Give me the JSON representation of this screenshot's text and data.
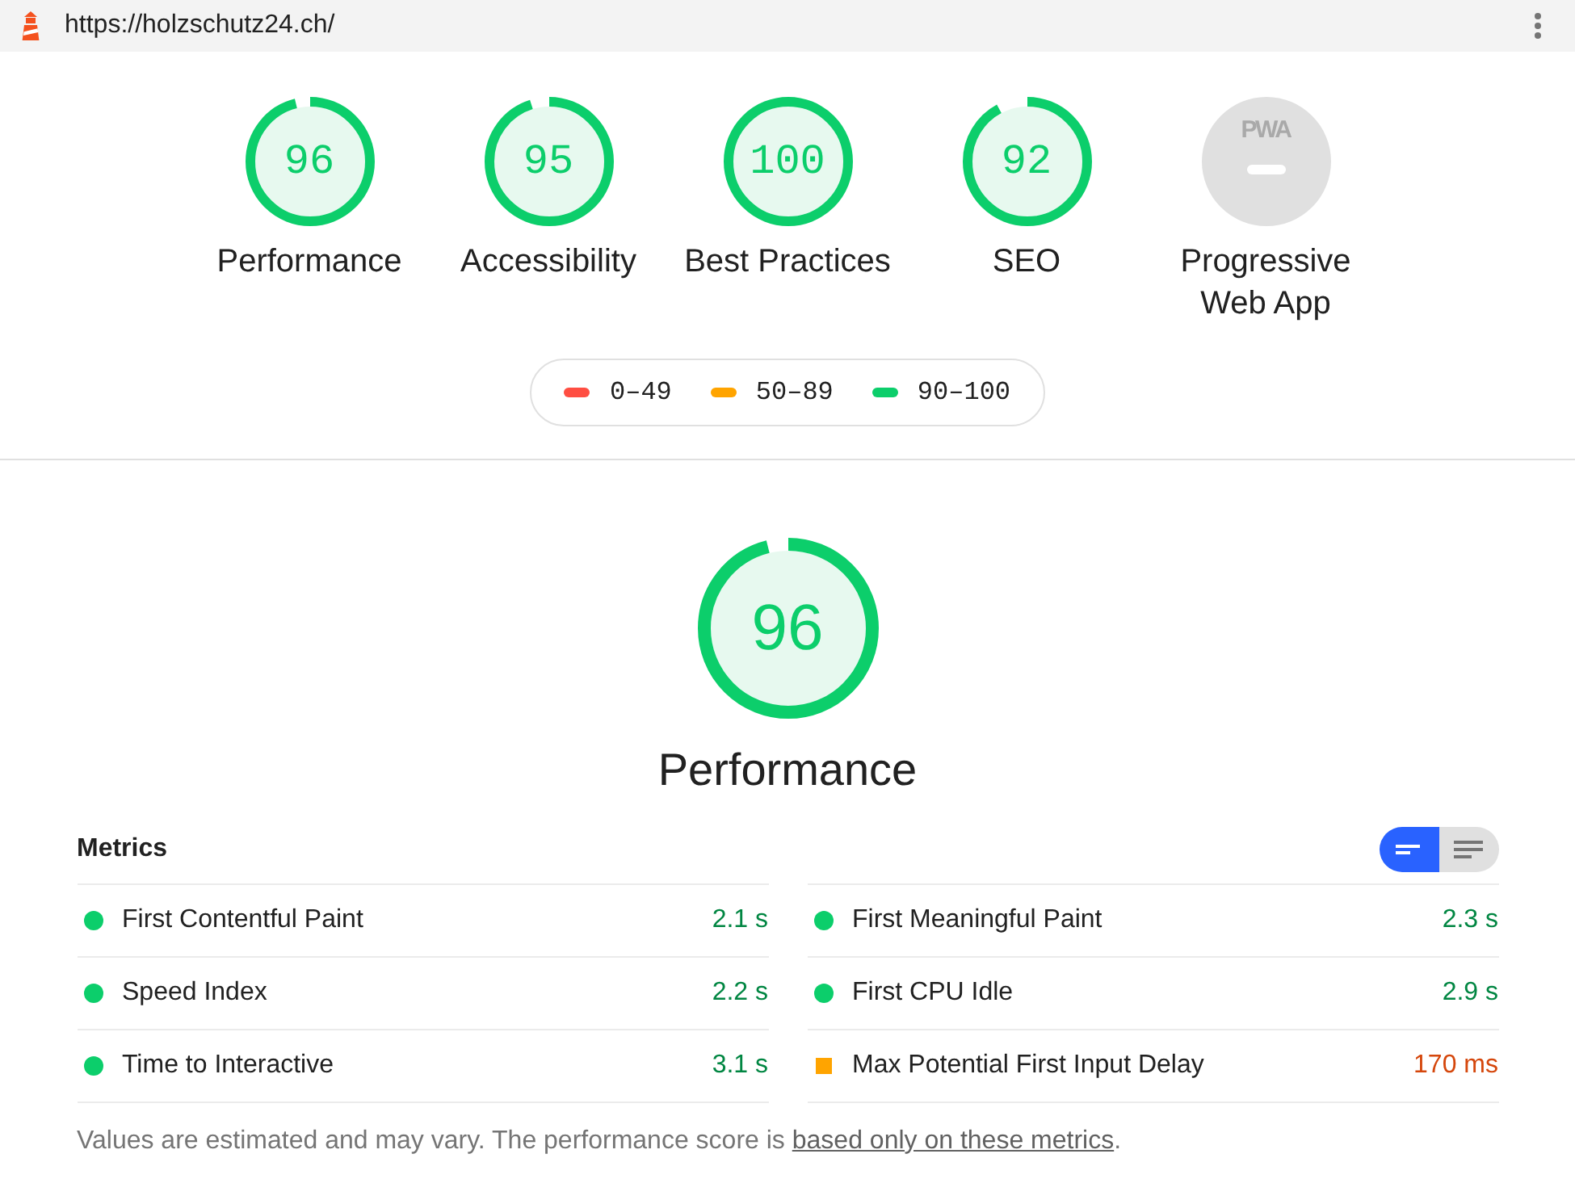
{
  "url_bar": {
    "url": "https://holzschutz24.ch/"
  },
  "categories": [
    {
      "kind": "score",
      "score": "96",
      "level": 0.96,
      "label": "Performance"
    },
    {
      "kind": "score",
      "score": "95",
      "level": 0.95,
      "label": "Accessibility"
    },
    {
      "kind": "score",
      "score": "100",
      "level": 1,
      "label": "Best Practices"
    },
    {
      "kind": "score",
      "score": "92",
      "level": 0.92,
      "label": "SEO"
    },
    {
      "kind": "pwa",
      "badge": "PWA",
      "label": "Progressive Web App"
    }
  ],
  "legend": [
    {
      "range": "0–49",
      "color": "#ff4e42"
    },
    {
      "range": "50–89",
      "color": "#ffa400"
    },
    {
      "range": "90–100",
      "color": "#0cce6b"
    }
  ],
  "performance": {
    "score": "96",
    "level": 0.96,
    "title": "Performance"
  },
  "metrics": {
    "title": "Metrics",
    "view_toggle": [
      {
        "kind": "compact",
        "selected": true
      },
      {
        "kind": "list",
        "selected": false
      }
    ],
    "items": [
      {
        "kind": "pass",
        "name": "First Contentful Paint",
        "value": "2.1 s"
      },
      {
        "kind": "pass",
        "name": "First Meaningful Paint",
        "value": "2.3 s"
      },
      {
        "kind": "pass",
        "name": "Speed Index",
        "value": "2.2 s"
      },
      {
        "kind": "pass",
        "name": "First CPU Idle",
        "value": "2.9 s"
      },
      {
        "kind": "pass",
        "name": "Time to Interactive",
        "value": "3.1 s"
      },
      {
        "kind": "average",
        "name": "Max Potential First Input Delay",
        "value": "170 ms"
      }
    ]
  },
  "note": {
    "text": "Values are estimated and may vary. The performance score is ",
    "link": "based only on these metrics",
    "end": "."
  }
}
